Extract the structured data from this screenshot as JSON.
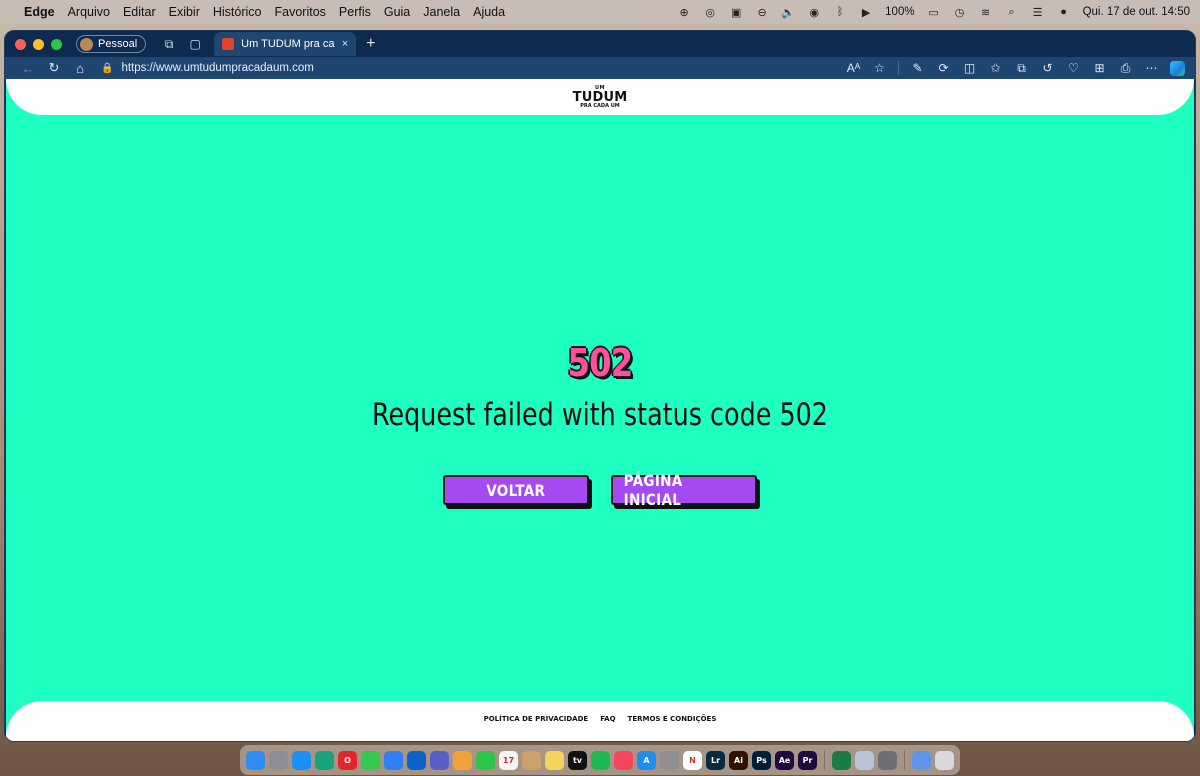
{
  "menubar": {
    "app_name": "Edge",
    "items": [
      "Arquivo",
      "Editar",
      "Exibir",
      "Histórico",
      "Favoritos",
      "Perfis",
      "Guia",
      "Janela",
      "Ajuda"
    ],
    "battery": "100%",
    "datetime": "Qui. 17 de out.  14:50"
  },
  "browser": {
    "profile_label": "Pessoal",
    "tab_title": "Um TUDUM pra cada um - Netflix",
    "url": "https://www.umtudumpracadaum.com",
    "new_tab_symbol": "+",
    "tab_close_symbol": "×"
  },
  "site": {
    "logo": {
      "top": "UM",
      "main": "TUDUM",
      "bottom": "PRA CADA UM"
    },
    "error_code": "502",
    "error_message": "Request failed with status code 502",
    "back_button": "VOLTAR",
    "home_button": "PÁGINA INICIAL",
    "footer_links": [
      "POLÍTICA DE PRIVACIDADE",
      "FAQ",
      "TERMOS E CONDIÇÕES"
    ]
  },
  "colors": {
    "page_background": "#1effc2",
    "button_purple": "#a44af0",
    "error_code_pink": "#ff4fa0",
    "browser_chrome": "#0e2a4e"
  },
  "dock": {
    "apps": [
      {
        "name": "finder",
        "label": "",
        "color": "#2f8cf0"
      },
      {
        "name": "launchpad",
        "label": "",
        "color": "#8d8d96"
      },
      {
        "name": "safari",
        "label": "",
        "color": "#1d8ff2"
      },
      {
        "name": "edge",
        "label": "",
        "color": "#1aa37a"
      },
      {
        "name": "opera",
        "label": "O",
        "color": "#e3242b"
      },
      {
        "name": "messages",
        "label": "",
        "color": "#32c94c"
      },
      {
        "name": "mail",
        "label": "",
        "color": "#2f7ff5"
      },
      {
        "name": "outlook",
        "label": "",
        "color": "#0a64c8"
      },
      {
        "name": "teams",
        "label": "",
        "color": "#5a5fc7"
      },
      {
        "name": "photos",
        "label": "",
        "color": "#f2a23a"
      },
      {
        "name": "facetime",
        "label": "",
        "color": "#2fc54a"
      },
      {
        "name": "calendar",
        "label": "17",
        "color": "#f4f4f4"
      },
      {
        "name": "finder-alt",
        "label": "",
        "color": "#caa16a"
      },
      {
        "name": "notes",
        "label": "",
        "color": "#f5d45e"
      },
      {
        "name": "tv",
        "label": "tv",
        "color": "#111111"
      },
      {
        "name": "spotify",
        "label": "",
        "color": "#1db954"
      },
      {
        "name": "music",
        "label": "",
        "color": "#f7455d"
      },
      {
        "name": "app-store",
        "label": "A",
        "color": "#1f8cf4"
      },
      {
        "name": "settings",
        "label": "",
        "color": "#8e8e93"
      },
      {
        "name": "notion",
        "label": "N",
        "color": "#ffffff"
      },
      {
        "name": "lightroom",
        "label": "Lr",
        "color": "#0b2a3f"
      },
      {
        "name": "illustrator",
        "label": "Ai",
        "color": "#2e1400"
      },
      {
        "name": "photoshop",
        "label": "Ps",
        "color": "#001e36"
      },
      {
        "name": "after-effects",
        "label": "Ae",
        "color": "#1e0a3c"
      },
      {
        "name": "premiere",
        "label": "Pr",
        "color": "#1e0a3c"
      },
      {
        "name": "excel",
        "label": "",
        "color": "#1d7a45"
      },
      {
        "name": "preview",
        "label": "",
        "color": "#b8c4d6"
      },
      {
        "name": "calculator",
        "label": "",
        "color": "#6e6e73"
      },
      {
        "name": "downloads",
        "label": "",
        "color": "#5e95e8"
      },
      {
        "name": "trash",
        "label": "",
        "color": "#d9d9de"
      }
    ]
  }
}
